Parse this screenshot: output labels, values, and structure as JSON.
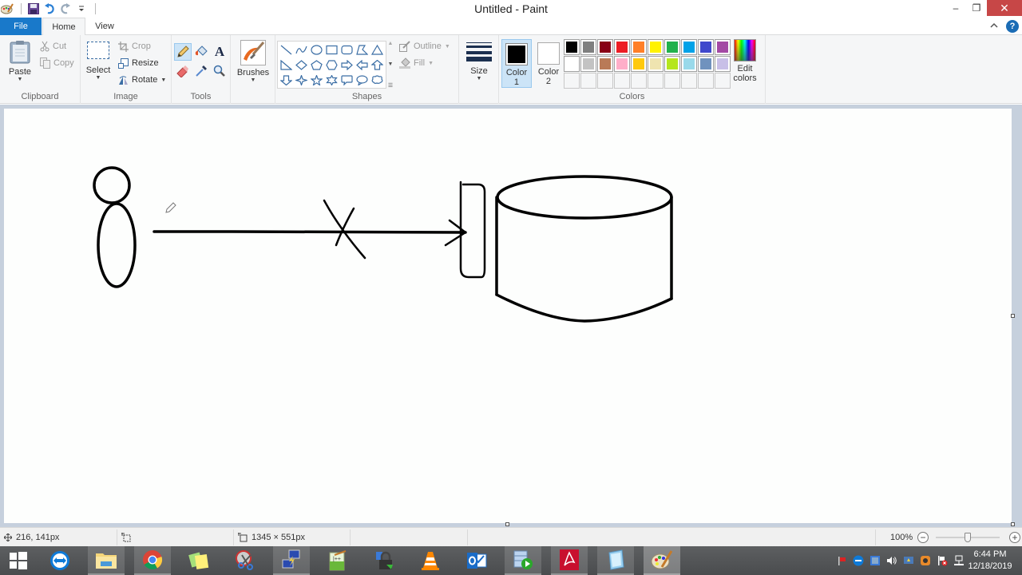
{
  "window": {
    "title": "Untitled - Paint",
    "minimize_label": "–",
    "restore_label": "❐",
    "close_label": "✕"
  },
  "quick_access": {
    "icons": [
      "paint-app-icon",
      "save-icon",
      "undo-icon",
      "redo-icon",
      "customize-dropdown-icon"
    ]
  },
  "tabs": {
    "file": "File",
    "home": "Home",
    "view": "View",
    "active": "Home"
  },
  "ribbon": {
    "clipboard": {
      "label": "Clipboard",
      "paste": "Paste",
      "cut": "Cut",
      "copy": "Copy"
    },
    "image": {
      "label": "Image",
      "select": "Select",
      "crop": "Crop",
      "resize": "Resize",
      "rotate": "Rotate"
    },
    "tools": {
      "label": "Tools",
      "items": [
        "pencil",
        "fill-with-color",
        "text",
        "eraser",
        "color-picker",
        "magnifier"
      ],
      "active": "pencil"
    },
    "brushes": {
      "label": "Brushes"
    },
    "shapes": {
      "label": "Shapes",
      "outline": "Outline",
      "fill": "Fill",
      "items": [
        "line",
        "curve",
        "oval",
        "rectangle",
        "rounded-rectangle",
        "polygon",
        "triangle",
        "right-triangle",
        "diamond",
        "pentagon",
        "hexagon",
        "right-arrow",
        "left-arrow",
        "up-arrow",
        "down-arrow",
        "four-point-star",
        "five-point-star",
        "six-point-star",
        "rounded-rectangular-callout",
        "oval-callout",
        "cloud-callout"
      ]
    },
    "size": {
      "label": "Size"
    },
    "colors": {
      "label": "Colors",
      "color1_label": "Color",
      "color1_num": "1",
      "color2_label": "Color",
      "color2_num": "2",
      "color1": "#000000",
      "color2": "#ffffff",
      "edit_label": "Edit",
      "edit_label2": "colors",
      "palette_row1": [
        "#000000",
        "#7f7f7f",
        "#880015",
        "#ed1c24",
        "#ff7f27",
        "#fff200",
        "#22b14c",
        "#00a2e8",
        "#3f48cc",
        "#a349a4"
      ],
      "palette_row2": [
        "#ffffff",
        "#c3c3c3",
        "#b97a57",
        "#ffaec9",
        "#ffc90e",
        "#efe4b0",
        "#b5e61d",
        "#99d9ea",
        "#7092be",
        "#c8bfe7"
      ],
      "palette_row3": [
        "",
        "",
        "",
        "",
        "",
        "",
        "",
        "",
        "",
        ""
      ]
    }
  },
  "status": {
    "cursor_position": "216, 141px",
    "selection_size": "",
    "image_size": "1345 × 551px",
    "zoom": "100%",
    "zoom_minus": "−",
    "zoom_plus": "+"
  },
  "taskbar": {
    "apps": [
      "start",
      "teamviewer",
      "file-explorer",
      "chrome",
      "sticky-notes",
      "snipping-tool",
      "remote-desktop",
      "notepad-plus-plus",
      "security-app",
      "vlc",
      "outlook",
      "media-player",
      "adobe-acrobat",
      "notepad",
      "paint"
    ],
    "active": "paint",
    "time": "6:44 PM",
    "date": "12/18/2019"
  }
}
